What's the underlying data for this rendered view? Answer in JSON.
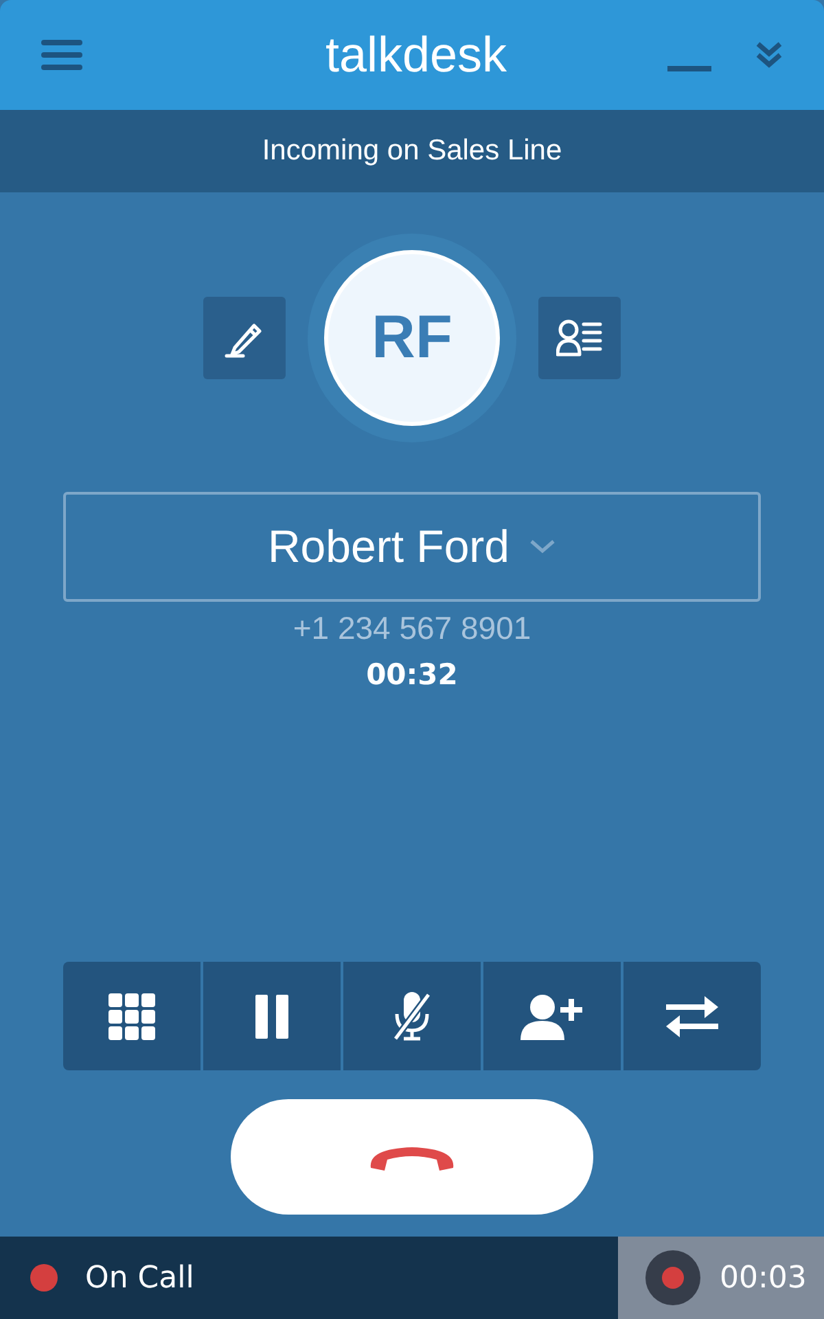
{
  "header": {
    "logo": "talkdesk"
  },
  "banner": {
    "text": "Incoming on Sales Line"
  },
  "contact": {
    "initials": "RF",
    "name": "Robert Ford",
    "phone": "+1 234 567 8901",
    "duration": "00:32"
  },
  "call_controls": [
    {
      "kind": "keypad"
    },
    {
      "kind": "hold"
    },
    {
      "kind": "mute"
    },
    {
      "kind": "add"
    },
    {
      "kind": "transfer"
    }
  ],
  "status_bar": {
    "label": "On Call",
    "color": "#d43f3f",
    "recording_time": "00:03"
  }
}
